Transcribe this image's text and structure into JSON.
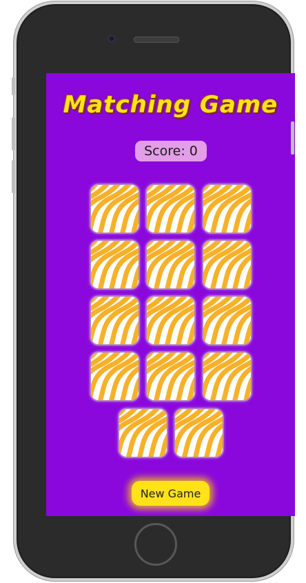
{
  "app": {
    "title": "Matching Game",
    "score_label": "Score: 0",
    "new_game_label": "New Game"
  },
  "cards": {
    "count": 14,
    "state": "face-down",
    "back_pattern": "wavy-stripes"
  },
  "colors": {
    "screen_bg": "#8a08dc",
    "title": "#ffe21a",
    "score_bg": "#e39ee8",
    "card_stripe": "#f6b12a",
    "card_bg": "#ffffff",
    "button_bg": "#ffe21a"
  },
  "icons": {
    "camera": "camera-icon",
    "speaker": "speaker-icon",
    "home": "home-button"
  }
}
